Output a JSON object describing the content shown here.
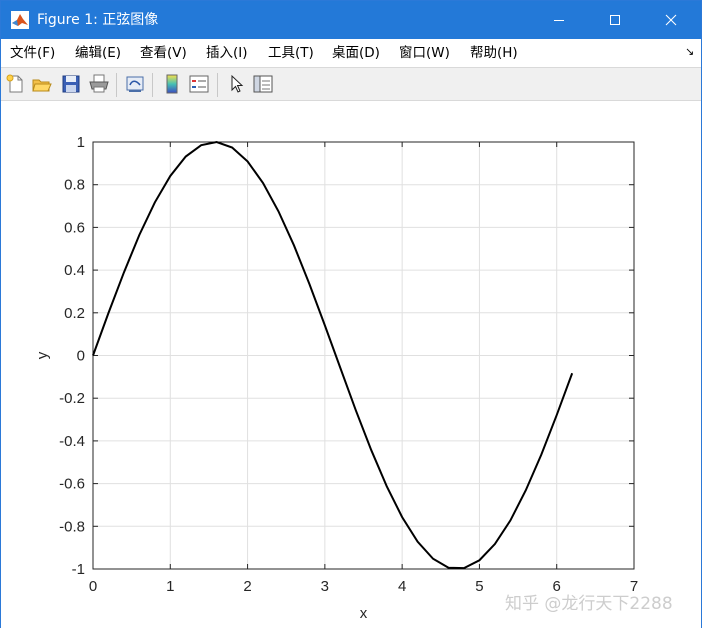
{
  "window": {
    "title": "Figure 1: 正弦图像",
    "title_bar_color": "#2379d8",
    "controls": [
      "minimize-icon",
      "maximize-icon",
      "close-icon"
    ]
  },
  "menu": {
    "items": [
      "文件(F)",
      "编辑(E)",
      "查看(V)",
      "插入(I)",
      "工具(T)",
      "桌面(D)",
      "窗口(W)",
      "帮助(H)"
    ],
    "overflow_icon": "dock-arrow-icon"
  },
  "toolbar": {
    "buttons": [
      "new-figure-icon",
      "open-file-icon",
      "save-icon",
      "print-icon",
      "link-plot-icon",
      "insert-colorbar-icon",
      "insert-legend-icon",
      "edit-plot-arrow-icon",
      "property-editor-icon"
    ]
  },
  "chart_data": {
    "type": "line",
    "title": "",
    "xlabel": "x",
    "ylabel": "y",
    "xlim": [
      0,
      7
    ],
    "ylim": [
      -1,
      1
    ],
    "xticks": [
      0,
      1,
      2,
      3,
      4,
      5,
      6,
      7
    ],
    "xtick_labels": [
      "0",
      "1",
      "2",
      "3",
      "4",
      "5",
      "6",
      "7"
    ],
    "yticks": [
      1,
      0.8,
      0.6,
      0.4,
      0.2,
      0,
      -0.2,
      -0.4,
      -0.6,
      -0.8,
      -1
    ],
    "ytick_labels": [
      "1",
      "0.8",
      "0.6",
      "0.4",
      "0.2",
      "0",
      "-0.2",
      "-0.4",
      "-0.6",
      "-0.8",
      "-1"
    ],
    "grid": true,
    "series": [
      {
        "color": "#000000",
        "x": [
          0,
          0.2,
          0.4,
          0.6,
          0.8,
          1.0,
          1.2,
          1.4,
          1.6,
          1.8,
          2.0,
          2.2,
          2.4,
          2.6,
          2.8,
          3.0,
          3.2,
          3.4,
          3.6,
          3.8,
          4.0,
          4.2,
          4.4,
          4.6,
          4.8,
          5.0,
          5.2,
          5.4,
          5.6,
          5.8,
          6.0,
          6.2
        ],
        "y": [
          0,
          0.199,
          0.389,
          0.565,
          0.717,
          0.841,
          0.932,
          0.985,
          1.0,
          0.974,
          0.909,
          0.808,
          0.675,
          0.516,
          0.335,
          0.141,
          -0.058,
          -0.256,
          -0.443,
          -0.612,
          -0.757,
          -0.872,
          -0.952,
          -0.994,
          -0.996,
          -0.959,
          -0.883,
          -0.773,
          -0.631,
          -0.465,
          -0.279,
          -0.083
        ]
      }
    ]
  },
  "watermark": "知乎 @龙行天下2288"
}
